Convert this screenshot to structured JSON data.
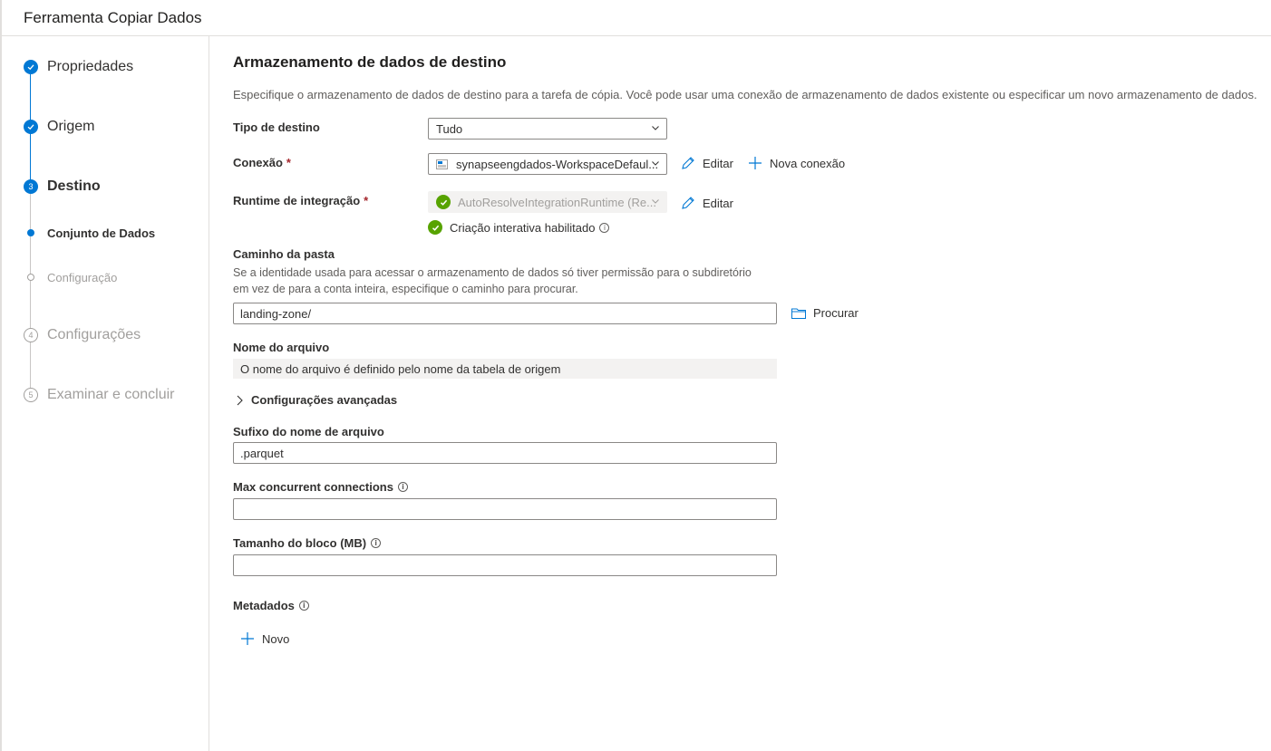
{
  "app": {
    "title": "Ferramenta Copiar Dados"
  },
  "steps": [
    {
      "label": "Propriedades",
      "state": "done",
      "icon": "check-icon"
    },
    {
      "label": "Origem",
      "state": "done",
      "icon": "check-icon"
    },
    {
      "label": "Destino",
      "state": "active",
      "number": "3"
    },
    {
      "label": "Conjunto de Dados",
      "state": "active-sub"
    },
    {
      "label": "Configuração",
      "state": "pending-sub"
    },
    {
      "label": "Configurações",
      "state": "pending",
      "number": "4"
    },
    {
      "label": "Examinar e concluir",
      "state": "pending",
      "number": "5"
    }
  ],
  "main": {
    "title": "Armazenamento de dados de destino",
    "description": "Especifique o armazenamento de dados de destino para a tarefa de cópia. Você pode usar uma conexão de armazenamento de dados existente ou especificar um novo armazenamento de dados.",
    "tipo_destino": {
      "label": "Tipo de destino",
      "value": "Tudo"
    },
    "conexao": {
      "label": "Conexão",
      "required": "*",
      "value": "synapseengdados-WorkspaceDefaul...",
      "edit_label": "Editar",
      "new_label": "Nova conexão"
    },
    "runtime": {
      "label": "Runtime de integração",
      "required": "*",
      "value": "AutoResolveIntegrationRuntime (Re...",
      "edit_label": "Editar",
      "status": "Criação interativa habilitado"
    },
    "caminho": {
      "label": "Caminho da pasta",
      "help_line1": "Se a identidade usada para acessar o armazenamento de dados só tiver permissão para o subdiretório",
      "help_line2": "em vez de para a conta inteira, especifique o caminho para procurar.",
      "value": "landing-zone/",
      "browse_label": "Procurar"
    },
    "nome_arquivo": {
      "label": "Nome do arquivo",
      "value": "O nome do arquivo é definido pelo nome da tabela de origem"
    },
    "avancadas": {
      "label": "Configurações avançadas"
    },
    "sufixo": {
      "label": "Sufixo do nome de arquivo",
      "value": ".parquet"
    },
    "max_conn": {
      "label": "Max concurrent connections",
      "value": ""
    },
    "bloco": {
      "label": "Tamanho do bloco (MB)",
      "value": ""
    },
    "metadados": {
      "label": "Metadados",
      "new_label": "Novo"
    },
    "info_glyph": "i"
  },
  "colors": {
    "accent": "#0078d4",
    "success": "#57a300",
    "required": "#a4262c"
  }
}
